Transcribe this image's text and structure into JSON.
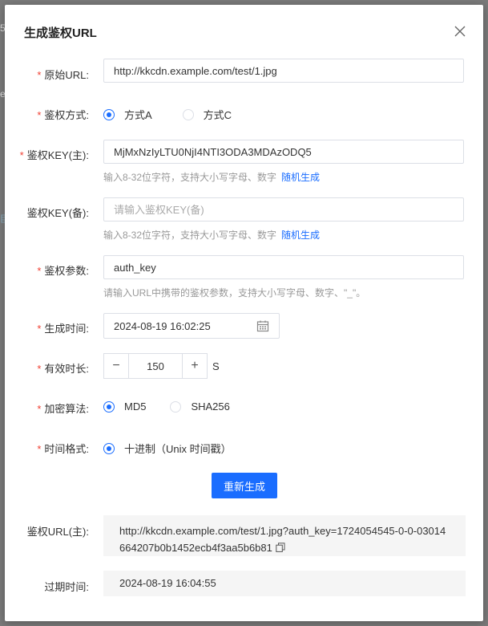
{
  "background": {
    "frag1": "5",
    "frag2": "e",
    "frag3": "臣"
  },
  "dialog": {
    "title": "生成鉴权URL"
  },
  "form": {
    "origin_url": {
      "label": "原始URL:",
      "value": "http://kkcdn.example.com/test/1.jpg"
    },
    "auth_method": {
      "label": "鉴权方式:",
      "options": [
        "方式A",
        "方式C"
      ],
      "selected": "方式A"
    },
    "key_main": {
      "label": "鉴权KEY(主):",
      "value": "MjMxNzIyLTU0NjI4NTI3ODA3MDAzODQ5",
      "help": "输入8-32位字符，支持大小写字母、数字",
      "link": "随机生成"
    },
    "key_backup": {
      "label": "鉴权KEY(备):",
      "placeholder": "请输入鉴权KEY(备)",
      "help": "输入8-32位字符，支持大小写字母、数字",
      "link": "随机生成"
    },
    "auth_param": {
      "label": "鉴权参数:",
      "value": "auth_key",
      "help": "请输入URL中携带的鉴权参数，支持大小写字母、数字、\"_\"。"
    },
    "gen_time": {
      "label": "生成时间:",
      "value": "2024-08-19 16:02:25"
    },
    "duration": {
      "label": "有效时长:",
      "value": "150",
      "unit": "S",
      "minus": "−",
      "plus": "+"
    },
    "algorithm": {
      "label": "加密算法:",
      "options": [
        "MD5",
        "SHA256"
      ],
      "selected": "MD5"
    },
    "time_format": {
      "label": "时间格式:",
      "options": [
        "十进制（Unix 时间戳）"
      ],
      "selected": "十进制（Unix 时间戳）"
    },
    "regenerate_label": "重新生成"
  },
  "result": {
    "url_label": "鉴权URL(主):",
    "url_value": "http://kkcdn.example.com/test/1.jpg?auth_key=1724054545-0-0-03014664207b0b1452ecb4f3aa5b6b81",
    "expire_label": "过期时间:",
    "expire_value": "2024-08-19 16:04:55"
  },
  "colors": {
    "primary": "#1a6dff",
    "required": "#f04134"
  }
}
